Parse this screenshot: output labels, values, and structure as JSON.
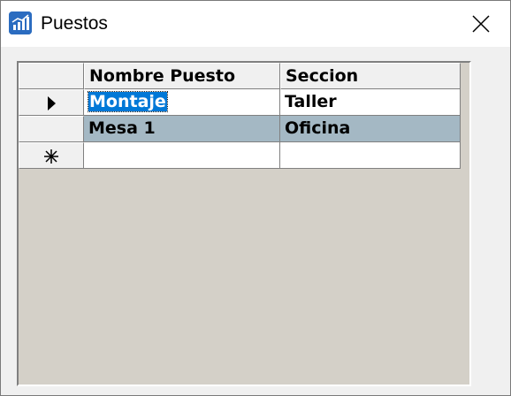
{
  "window": {
    "title": "Puestos",
    "icon": "chart-app-icon",
    "close_icon": "close-icon"
  },
  "grid": {
    "columns": [
      "",
      "Nombre Puesto",
      "Seccion"
    ],
    "rows": [
      {
        "marker": "current-row-icon",
        "nombre_puesto": "Montaje",
        "seccion": "Taller",
        "state": "editing"
      },
      {
        "marker": "",
        "nombre_puesto": "Mesa 1",
        "seccion": "Oficina",
        "state": "selected"
      },
      {
        "marker": "new-row-icon",
        "nombre_puesto": "",
        "seccion": "",
        "state": "new"
      }
    ]
  }
}
